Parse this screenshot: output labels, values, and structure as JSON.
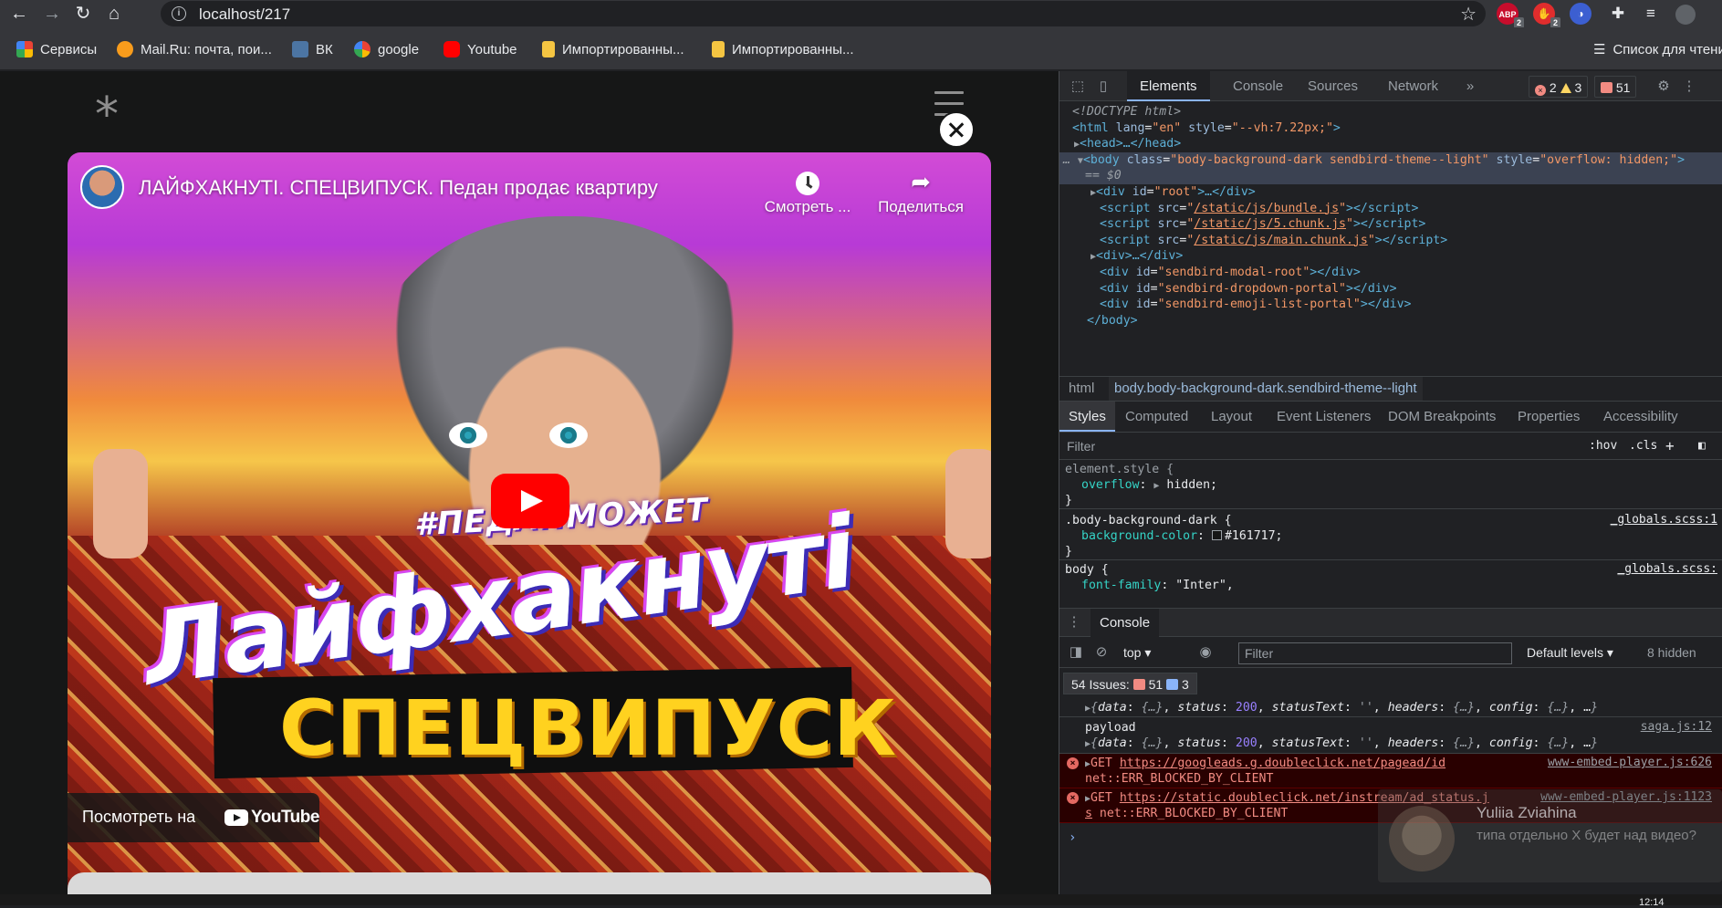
{
  "browser": {
    "url": "localhost/217",
    "bookmarks": [
      {
        "label": "Сервисы",
        "color": "#4285f4"
      },
      {
        "label": "Mail.Ru: почта, пои...",
        "color": "#f89c1c"
      },
      {
        "label": "ВК",
        "color": "#4c75a3"
      },
      {
        "label": "google",
        "color": "#ffffff"
      },
      {
        "label": "Youtube",
        "color": "#ff0000"
      },
      {
        "label": "Импортированны...",
        "color": "#f5c542"
      },
      {
        "label": "Импортированны...",
        "color": "#f5c542"
      }
    ],
    "reading_list": "Список для чтения",
    "extensions": [
      {
        "name": "adblock-icon",
        "text": "ABP",
        "badge": "2",
        "color": "#c70d2c"
      },
      {
        "name": "adblock-plus-icon",
        "text": "✋",
        "badge": "2",
        "color": "#e02d2d"
      },
      {
        "name": "vpn-icon",
        "text": "◑",
        "badge": "",
        "color": "#3c5fd1"
      }
    ]
  },
  "page": {
    "logo": "*",
    "video": {
      "title": "ЛАЙФХАКНУТІ. СПЕЦВИПУСК. Педан продає квартиру",
      "watch_later": "Смотреть ...",
      "share": "Поделиться",
      "watch_on": "Посмотреть на",
      "yt_brand": "YouTube",
      "thumb_tag": "#ПЕДАНМОЖЕТ",
      "thumb_title": "Лайфхакнуті",
      "thumb_banner": "СПЕЦВИПУСК"
    }
  },
  "devtools": {
    "tabs": [
      "Elements",
      "Console",
      "Sources",
      "Network"
    ],
    "errors": "2",
    "warnings": "3",
    "issues_count": "51",
    "dom": {
      "doctype": "<!DOCTYPE html>",
      "html_open": {
        "tag": "html",
        "attrs": [
          [
            "lang",
            "en"
          ],
          [
            "style",
            "--vh:7.22px;"
          ]
        ]
      },
      "head": "<head>…</head>",
      "body_class": "body-background-dark sendbird-theme--light",
      "body_style": "overflow: hidden;",
      "sel_marker": "== $0",
      "children": [
        {
          "kind": "div",
          "id": "root",
          "collapsed": true
        },
        {
          "kind": "script",
          "src": "/static/js/bundle.js"
        },
        {
          "kind": "script",
          "src": "/static/js/5.chunk.js"
        },
        {
          "kind": "script",
          "src": "/static/js/main.chunk.js"
        },
        {
          "kind": "divc",
          "text": "<div>…</div>"
        },
        {
          "kind": "div",
          "id": "sendbird-modal-root"
        },
        {
          "kind": "div",
          "id": "sendbird-dropdown-portal"
        },
        {
          "kind": "div",
          "id": "sendbird-emoji-list-portal"
        }
      ],
      "body_close": "</body>"
    },
    "breadcrumb": [
      "html",
      "body.body-background-dark.sendbird-theme--light"
    ],
    "subtabs": [
      "Styles",
      "Computed",
      "Layout",
      "Event Listeners",
      "DOM Breakpoints",
      "Properties",
      "Accessibility"
    ],
    "filter_placeholder": "Filter",
    "hov": ":hov",
    "cls": ".cls",
    "rules": [
      {
        "selector": "element.style {",
        "prop": "overflow",
        "val": "hidden",
        "src": ""
      },
      {
        "selector": ".body-background-dark {",
        "prop": "background-color",
        "val": "#161717",
        "src": "_globals.scss:1"
      },
      {
        "selector": "body {",
        "prop": "font-family",
        "val": "\"Inter\",",
        "src": "_globals.scss:"
      }
    ],
    "drawer_tab": "Console",
    "console": {
      "context": "top",
      "filter": "Filter",
      "levels": "Default levels",
      "hidden": "8 hidden",
      "issues_label": "54 Issues:",
      "issues_err": "51",
      "issues_info": "3",
      "payload_label": "payload",
      "payload_src": "saga.js:12",
      "payload_obj": {
        "data": "{…}",
        "status": "200",
        "statusText": "''",
        "headers": "{…}",
        "config": "{…}"
      },
      "errors": [
        {
          "method": "GET",
          "url": "https://googleads.g.doubleclick.net/pagead/id",
          "src": "www-embed-player.js:626",
          "msg": "net::ERR_BLOCKED_BY_CLIENT",
          "cont": ""
        },
        {
          "method": "GET",
          "url": "https://static.doubleclick.net/instream/ad_status.j",
          "src": "www-embed-player.js:1123",
          "msg": "net::ERR_BLOCKED_BY_CLIENT",
          "cont": "s"
        }
      ],
      "prompt": "›"
    }
  },
  "notification": {
    "name": "Yuliia Zviahina",
    "message": "типа отдельно X будет над видео?"
  },
  "taskbar": {
    "clock": "12:14"
  }
}
